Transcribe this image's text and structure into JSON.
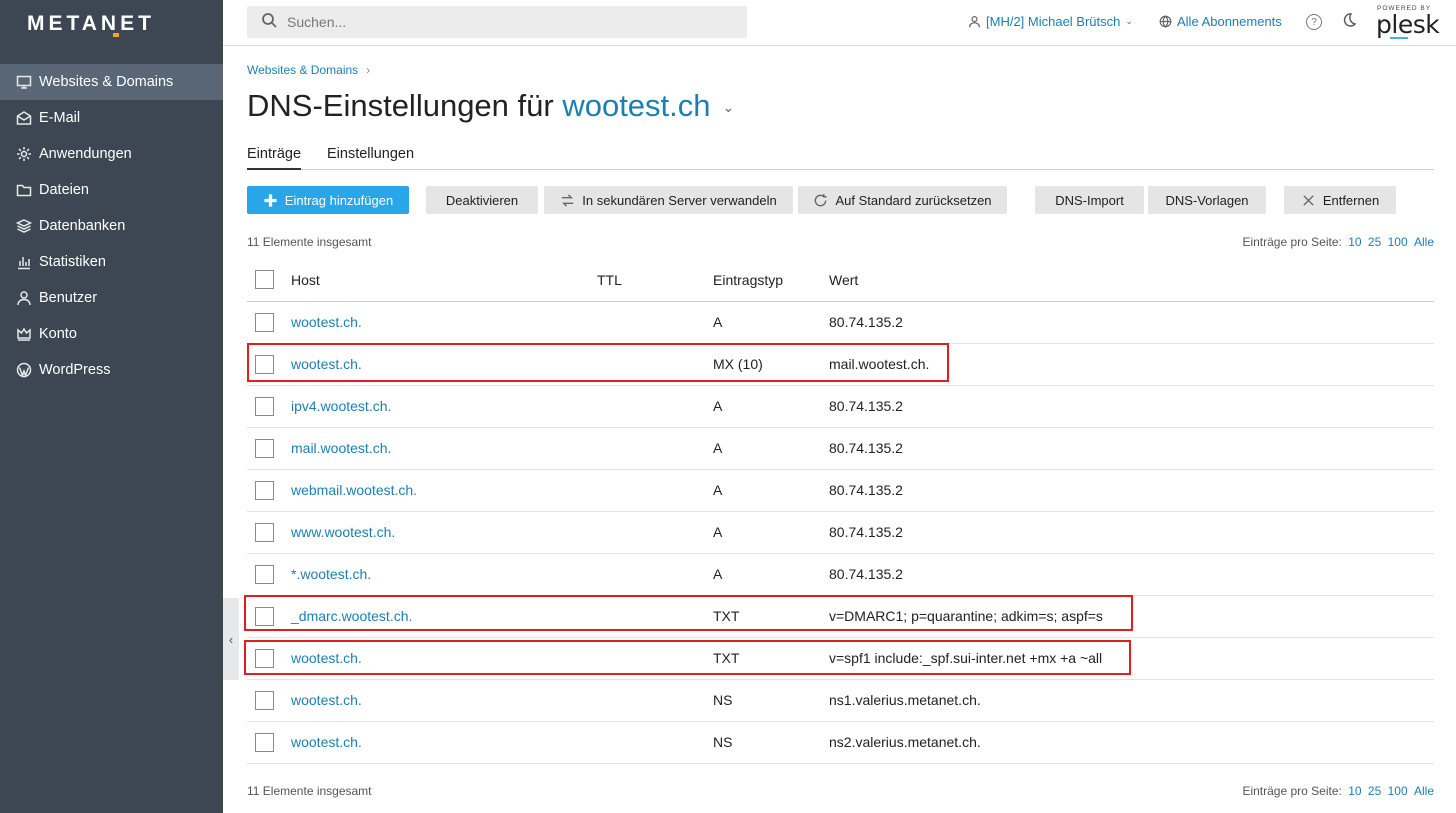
{
  "brand": {
    "logo_text": "METANET",
    "powered_by": "POWERED BY",
    "plesk_text": "plesk"
  },
  "sidebar": {
    "items": [
      {
        "label": "Websites & Domains",
        "icon": "monitor-icon",
        "active": true
      },
      {
        "label": "E-Mail",
        "icon": "envelope-icon"
      },
      {
        "label": "Anwendungen",
        "icon": "gear-icon"
      },
      {
        "label": "Dateien",
        "icon": "folder-icon"
      },
      {
        "label": "Datenbanken",
        "icon": "layers-icon"
      },
      {
        "label": "Statistiken",
        "icon": "bar-chart-icon"
      },
      {
        "label": "Benutzer",
        "icon": "user-icon"
      },
      {
        "label": "Konto",
        "icon": "crown-icon"
      },
      {
        "label": "WordPress",
        "icon": "wordpress-icon"
      }
    ]
  },
  "header": {
    "search_placeholder": "Suchen...",
    "user_label": "[MH/2] Michael Brütsch",
    "subscriptions_label": "Alle Abonnements",
    "help_symbol": "?"
  },
  "page": {
    "breadcrumb": "Websites & Domains",
    "title_prefix": "DNS-Einstellungen für",
    "title_domain": "wootest.ch",
    "tabs": [
      "Einträge",
      "Einstellungen"
    ]
  },
  "toolbar": {
    "add": "Eintrag hinzufügen",
    "deactivate": "Deaktivieren",
    "secondary": "In sekundären Server verwandeln",
    "reset": "Auf Standard zurücksetzen",
    "import": "DNS-Import",
    "templates": "DNS-Vorlagen",
    "remove": "Entfernen"
  },
  "list": {
    "total_text": "11 Elemente insgesamt",
    "per_page_label": "Einträge pro Seite:",
    "per_page_options": [
      "10",
      "25",
      "100",
      "Alle"
    ],
    "columns": {
      "host": "Host",
      "ttl": "TTL",
      "type": "Eintragstyp",
      "value": "Wert"
    },
    "rows": [
      {
        "host": "wootest.ch.",
        "ttl": "",
        "type": "A",
        "value": "80.74.135.2"
      },
      {
        "host": "wootest.ch.",
        "ttl": "",
        "type": "MX (10)",
        "value": "mail.wootest.ch."
      },
      {
        "host": "ipv4.wootest.ch.",
        "ttl": "",
        "type": "A",
        "value": "80.74.135.2"
      },
      {
        "host": "mail.wootest.ch.",
        "ttl": "",
        "type": "A",
        "value": "80.74.135.2"
      },
      {
        "host": "webmail.wootest.ch.",
        "ttl": "",
        "type": "A",
        "value": "80.74.135.2"
      },
      {
        "host": "www.wootest.ch.",
        "ttl": "",
        "type": "A",
        "value": "80.74.135.2"
      },
      {
        "host": "*.wootest.ch.",
        "ttl": "",
        "type": "A",
        "value": "80.74.135.2"
      },
      {
        "host": "_dmarc.wootest.ch.",
        "ttl": "",
        "type": "TXT",
        "value": "v=DMARC1; p=quarantine; adkim=s; aspf=s"
      },
      {
        "host": "wootest.ch.",
        "ttl": "",
        "type": "TXT",
        "value": "v=spf1 include:_spf.sui-inter.net +mx +a ~all"
      },
      {
        "host": "wootest.ch.",
        "ttl": "",
        "type": "NS",
        "value": "ns1.valerius.metanet.ch."
      },
      {
        "host": "wootest.ch.",
        "ttl": "",
        "type": "NS",
        "value": "ns2.valerius.metanet.ch."
      }
    ]
  },
  "colors": {
    "sidebar_bg": "#3c4753",
    "active_item": "#586675",
    "link": "#1b7fb4",
    "primary_button": "#28a6e8",
    "highlight": "#e01e1e"
  }
}
